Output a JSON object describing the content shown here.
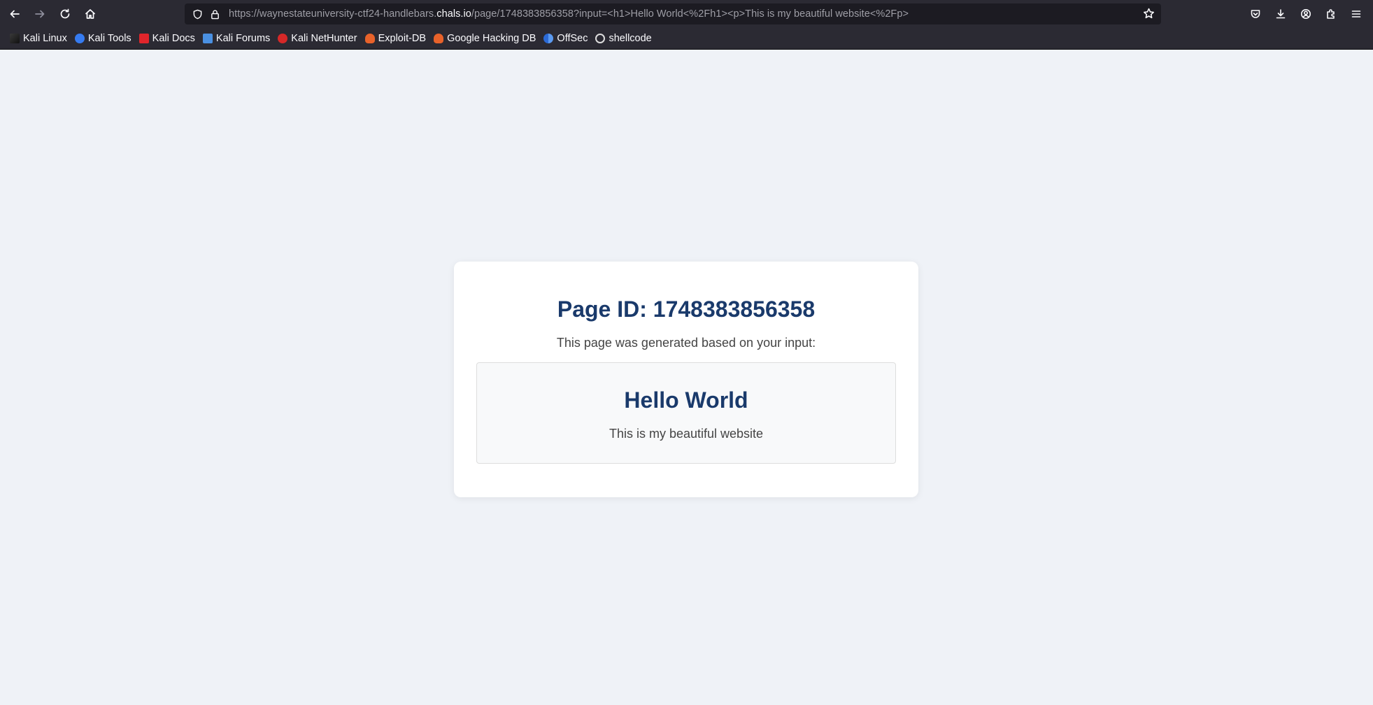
{
  "browser": {
    "url": {
      "prefix": "https://waynestateuniversity-ctf24-handlebars.",
      "host": "chals.io",
      "suffix": "/page/1748383856358?input=<h1>Hello World<%2Fh1><p>This is my beautiful website<%2Fp>"
    },
    "nav_icons": [
      "back-arrow-icon",
      "forward-arrow-icon",
      "reload-icon",
      "home-icon"
    ],
    "toolbar_icons": [
      "pocket-icon",
      "downloads-icon",
      "account-icon",
      "extensions-icon",
      "menu-icon"
    ]
  },
  "bookmarks": [
    {
      "label": "Kali Linux",
      "icon": "kali-dragon-icon",
      "color": "#1a1a1a"
    },
    {
      "label": "Kali Tools",
      "icon": "kali-tools-icon",
      "color": "#367bf0"
    },
    {
      "label": "Kali Docs",
      "icon": "kali-docs-icon",
      "color": "#e0252b"
    },
    {
      "label": "Kali Forums",
      "icon": "kali-forums-icon",
      "color": "#4a90e2"
    },
    {
      "label": "Kali NetHunter",
      "icon": "nethunter-icon",
      "color": "#d62828"
    },
    {
      "label": "Exploit-DB",
      "icon": "exploit-db-icon",
      "color": "#e8622a"
    },
    {
      "label": "Google Hacking DB",
      "icon": "ghdb-icon",
      "color": "#e8622a"
    },
    {
      "label": "OffSec",
      "icon": "offsec-icon",
      "color": "#3d7be0"
    },
    {
      "label": "shellcode",
      "icon": "shellcode-icon",
      "color": "#dddddd"
    }
  ],
  "page": {
    "title": "Page ID: 1748383856358",
    "subtitle": "This page was generated based on your input:",
    "content": {
      "heading": "Hello World",
      "paragraph": "This is my beautiful website"
    }
  },
  "colors": {
    "heading": "#1a3a6b",
    "background": "#eff2f7",
    "chrome": "#2b2a33"
  }
}
